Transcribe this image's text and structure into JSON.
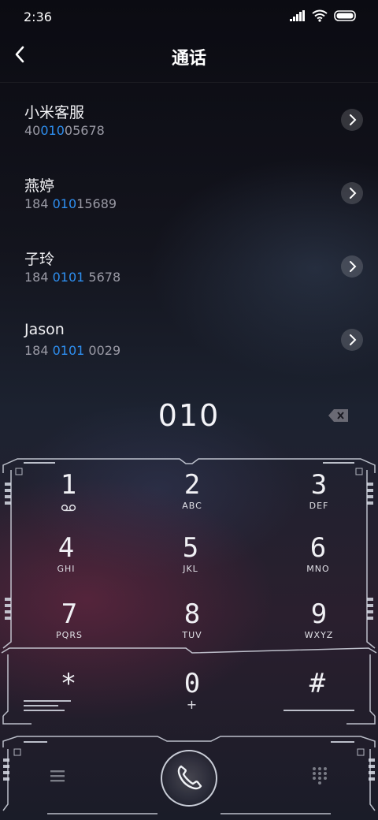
{
  "status_bar": {
    "time": "2:36",
    "icons": [
      "signal-icon",
      "wifi-icon",
      "battery-icon"
    ]
  },
  "header": {
    "title": "通话",
    "back_icon": "chevron-left-icon"
  },
  "contacts": [
    {
      "name": "小米客服",
      "number_pre": "40",
      "number_hl": "010",
      "number_post": "05678"
    },
    {
      "name": "燕婷",
      "number_pre": "184 ",
      "number_hl": "010",
      "number_post": "15689"
    },
    {
      "name": "子玲",
      "number_pre": "184 ",
      "number_hl": "0101",
      "number_post": " 5678"
    },
    {
      "name": "Jason",
      "number_pre": "184 ",
      "number_hl": "0101",
      "number_post": " 0029"
    }
  ],
  "dial": {
    "input": "010",
    "backspace_icon": "backspace-icon"
  },
  "keys": [
    {
      "digit": "1",
      "letters": ""
    },
    {
      "digit": "2",
      "letters": "ABC"
    },
    {
      "digit": "3",
      "letters": "DEF"
    },
    {
      "digit": "4",
      "letters": "GHI"
    },
    {
      "digit": "5",
      "letters": "JKL"
    },
    {
      "digit": "6",
      "letters": "MNO"
    },
    {
      "digit": "7",
      "letters": "PQRS"
    },
    {
      "digit": "8",
      "letters": "TUV"
    },
    {
      "digit": "9",
      "letters": "WXYZ"
    },
    {
      "digit": "*",
      "letters": ""
    },
    {
      "digit": "0",
      "letters": "+"
    },
    {
      "digit": "#",
      "letters": ""
    }
  ],
  "bottom": {
    "menu_icon": "menu-icon",
    "call_icon": "phone-icon",
    "keypad_icon": "dialpad-icon"
  },
  "colors": {
    "highlight": "#2e8ff0",
    "background": "#13141d"
  }
}
